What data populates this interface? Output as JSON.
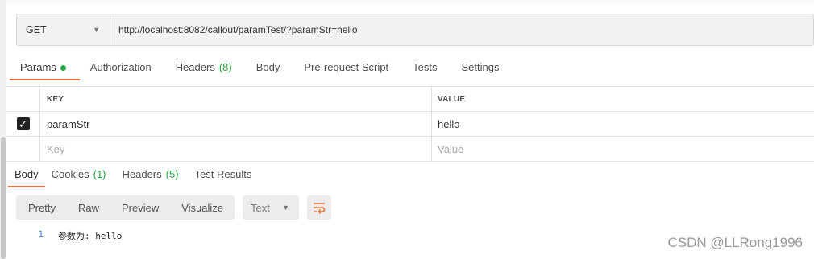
{
  "request": {
    "method": "GET",
    "url": "http://localhost:8082/callout/paramTest/?paramStr=hello"
  },
  "request_tabs": [
    {
      "label": "Params",
      "active": true,
      "dot": true
    },
    {
      "label": "Authorization"
    },
    {
      "label": "Headers",
      "count": "(8)"
    },
    {
      "label": "Body"
    },
    {
      "label": "Pre-request Script"
    },
    {
      "label": "Tests"
    },
    {
      "label": "Settings"
    }
  ],
  "params": {
    "columns": [
      "KEY",
      "VALUE"
    ],
    "rows": [
      {
        "checked": true,
        "key": "paramStr",
        "value": "hello"
      }
    ],
    "placeholder": {
      "key": "Key",
      "value": "Value"
    }
  },
  "response_tabs": [
    {
      "label": "Body",
      "active": true
    },
    {
      "label": "Cookies",
      "count": "(1)"
    },
    {
      "label": "Headers",
      "count": "(5)"
    },
    {
      "label": "Test Results"
    }
  ],
  "response_toolbar": {
    "views": [
      "Pretty",
      "Raw",
      "Preview",
      "Visualize"
    ],
    "format": "Text",
    "wrap_icon": "wrap-lines-icon"
  },
  "response_body": {
    "lines": [
      {
        "number": "1",
        "text": "参数为: hello"
      }
    ]
  },
  "watermark": "CSDN @LLRong1996",
  "colors": {
    "accent": "#e8703a",
    "count_green": "#28a745",
    "line_number": "#3a7fc6"
  }
}
